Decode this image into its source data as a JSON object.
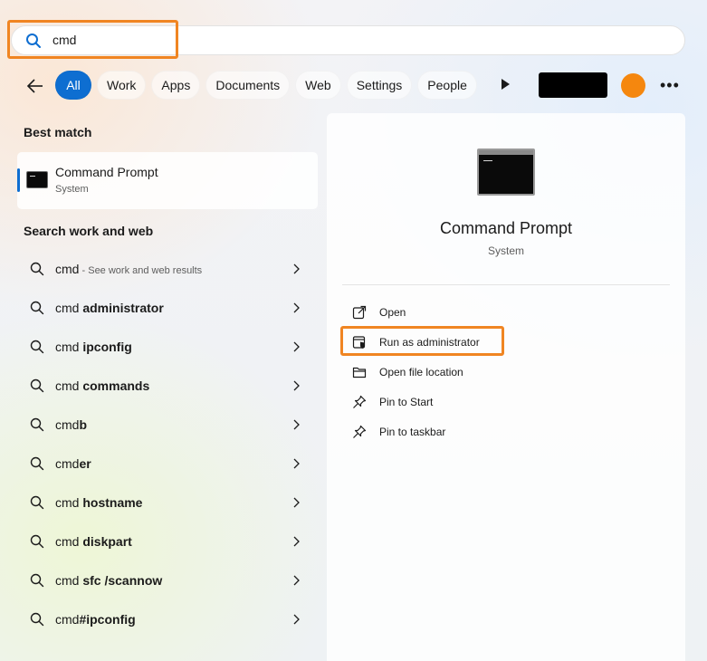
{
  "search": {
    "query": "cmd"
  },
  "filters": {
    "chips": [
      "All",
      "Work",
      "Apps",
      "Documents",
      "Web",
      "Settings",
      "People"
    ],
    "active": "All"
  },
  "best_match": {
    "heading": "Best match",
    "title": "Command Prompt",
    "subtitle": "System"
  },
  "suggestions": {
    "heading": "Search work and web",
    "items": [
      {
        "prefix": "cmd",
        "bold": "",
        "note": " - See work and web results"
      },
      {
        "prefix": "cmd ",
        "bold": "administrator",
        "note": ""
      },
      {
        "prefix": "cmd ",
        "bold": "ipconfig",
        "note": ""
      },
      {
        "prefix": "cmd ",
        "bold": "commands",
        "note": ""
      },
      {
        "prefix": "cmd",
        "bold": "b",
        "note": ""
      },
      {
        "prefix": "cmd",
        "bold": "er",
        "note": ""
      },
      {
        "prefix": "cmd ",
        "bold": "hostname",
        "note": ""
      },
      {
        "prefix": "cmd ",
        "bold": "diskpart",
        "note": ""
      },
      {
        "prefix": "cmd ",
        "bold": "sfc /scannow",
        "note": ""
      },
      {
        "prefix": "cmd",
        "bold": "#ipconfig",
        "note": ""
      }
    ]
  },
  "detail": {
    "title": "Command Prompt",
    "subtitle": "System",
    "actions": [
      {
        "label": "Open",
        "icon": "open-external-icon"
      },
      {
        "label": "Run as administrator",
        "icon": "shield-admin-icon"
      },
      {
        "label": "Open file location",
        "icon": "folder-icon"
      },
      {
        "label": "Pin to Start",
        "icon": "pin-icon"
      },
      {
        "label": "Pin to taskbar",
        "icon": "pin-icon"
      }
    ]
  },
  "colors": {
    "accent": "#0e6ed1",
    "highlight": "#f08522",
    "avatar": "#f5870e"
  }
}
